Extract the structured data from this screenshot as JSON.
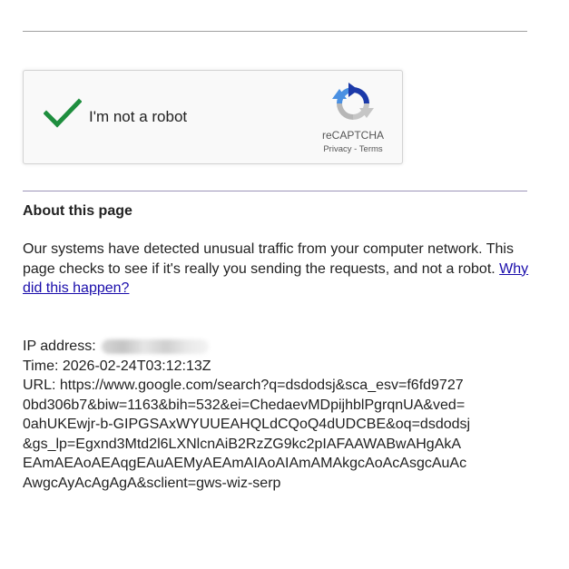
{
  "recaptcha": {
    "checkbox_label": "I'm not a robot",
    "brand": "reCAPTCHA",
    "privacy_link": "Privacy",
    "separator": " - ",
    "terms_link": "Terms",
    "checked": true,
    "check_color": "#1e8e3e"
  },
  "about": {
    "title": "About this page",
    "body": "Our systems have detected unusual traffic from your computer network. This page checks to see if it's really you sending the requests, and not a robot. ",
    "why_link": "Why did this happen?"
  },
  "info": {
    "ip_label": "IP address:",
    "time_label": "Time:",
    "time_value": "2026-02-24T03:12:13Z",
    "url_label": "URL:",
    "url_lines": [
      "https://www.google.com/search?q=dsdodsj&sca_esv=f6fd9727",
      "0bd306b7&biw=1163&bih=532&ei=ChedaevMDpijhblPgrqnUA&ved=",
      "0ahUKEwjr-b-GIPGSAxWYUUEAHQLdCQoQ4dUDCBE&oq=dsdodsj",
      "&gs_lp=Egxnd3Mtd2l6LXNlcnAiB2RzZG9kc2pIAFAAWABwAHgAkA",
      "EAmAEAoAEAqgEAuAEMyAEAmAIAoAIAmAMAkgcAoAcAsgcAuAc",
      "AwgcAyAcAgAgA&sclient=gws-wiz-serp"
    ]
  },
  "colors": {
    "link": "#1a0dab",
    "text": "#222222"
  }
}
